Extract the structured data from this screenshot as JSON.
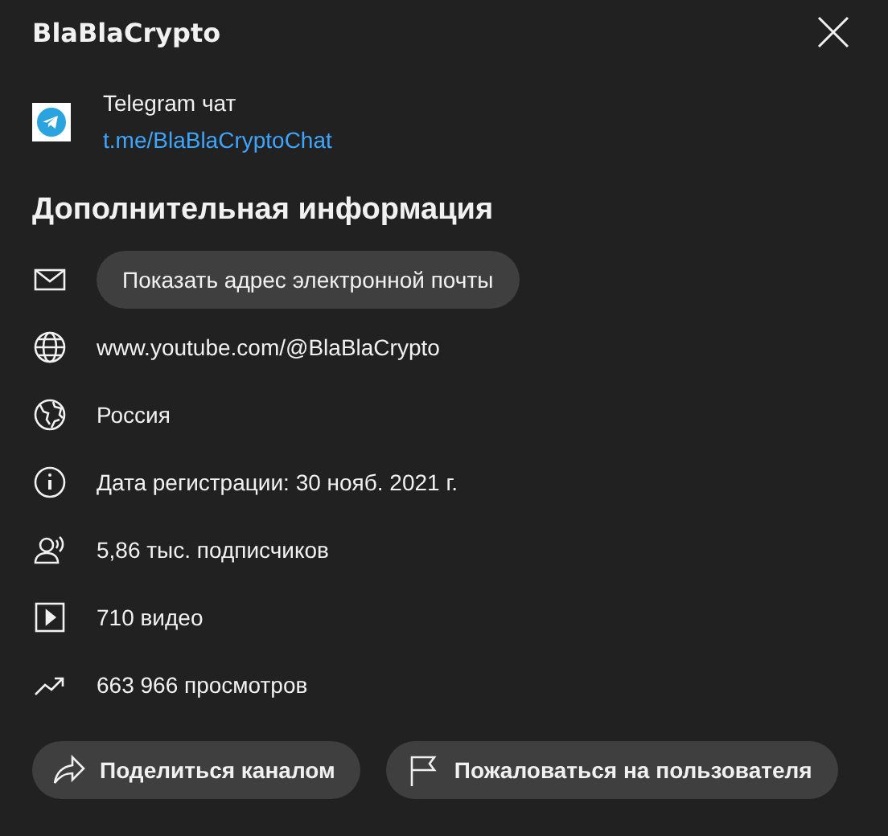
{
  "title": "BlaBlaCrypto",
  "links": [
    {
      "title": "Telegram чат",
      "url": "t.me/BlaBlaCryptoChat"
    }
  ],
  "section_title": "Дополнительная информация",
  "details": [
    {
      "kind": "email",
      "text": "Показать адрес электронной почты"
    },
    {
      "kind": "website",
      "text": "www.youtube.com/@BlaBlaCrypto"
    },
    {
      "kind": "country",
      "text": "Россия"
    },
    {
      "kind": "joined",
      "text": "Дата регистрации: 30 нояб. 2021 г."
    },
    {
      "kind": "subscribers",
      "text": "5,86 тыс. подписчиков"
    },
    {
      "kind": "videos",
      "text": "710 видео"
    },
    {
      "kind": "views",
      "text": "663 966 просмотров"
    }
  ],
  "buttons": [
    {
      "kind": "share",
      "label": "Поделиться каналом"
    },
    {
      "kind": "report",
      "label": "Пожаловаться на пользователя"
    }
  ]
}
